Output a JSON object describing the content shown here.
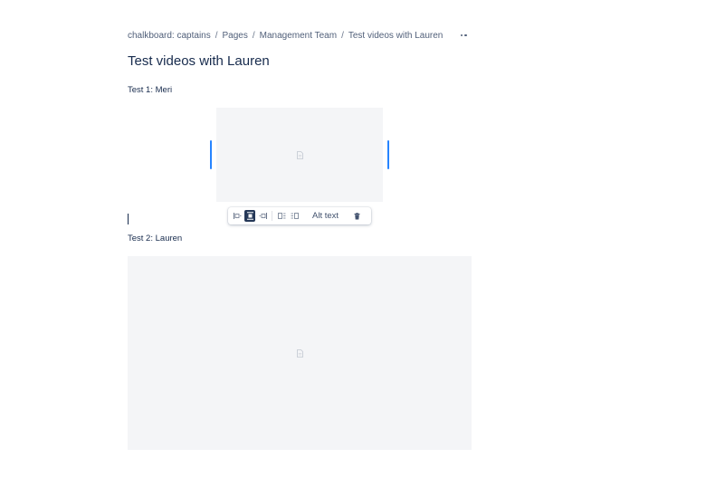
{
  "breadcrumb": {
    "items": [
      "chalkboard: captains",
      "Pages",
      "Management Team",
      "Test videos with Lauren"
    ],
    "separator": "/"
  },
  "header": {
    "more_actions_icon": "more-horizontal-icon"
  },
  "page": {
    "title": "Test videos with Lauren",
    "sections": [
      {
        "label": "Test 1: Meri",
        "media_icon": "file-icon"
      },
      {
        "label": "Test 2: Lauren",
        "media_icon": "file-icon"
      }
    ]
  },
  "media_toolbar": {
    "layout_buttons": [
      {
        "name": "align-left-icon",
        "active": false
      },
      {
        "name": "align-center-icon",
        "active": true
      },
      {
        "name": "align-right-icon",
        "active": false
      },
      {
        "name": "wrap-left-icon",
        "active": false
      },
      {
        "name": "wrap-right-icon",
        "active": false
      }
    ],
    "alt_text_label": "Alt text",
    "delete_icon": "trash-icon"
  },
  "colors": {
    "text": "#172b4d",
    "subtle_text": "#505f79",
    "placeholder_bg": "#f4f5f7",
    "selection_blue": "#2684ff",
    "active_button": "#253858"
  }
}
